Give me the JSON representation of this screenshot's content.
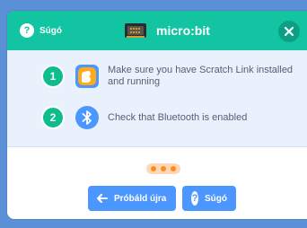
{
  "header": {
    "help_label": "Súgó",
    "title": "micro:bit",
    "close_icon": "close-icon"
  },
  "steps": [
    {
      "number": "1",
      "icon": "scratch-link-icon",
      "text": "Make sure you have Scratch Link installed and running"
    },
    {
      "number": "2",
      "icon": "bluetooth-icon",
      "text": "Check that Bluetooth is enabled"
    }
  ],
  "footer": {
    "back_label": "Próbáld újra",
    "help_label": "Súgó"
  },
  "colors": {
    "header": "#13c4a3",
    "accent": "#4c97ff",
    "step_badge": "#0fbd8c",
    "dots": "#ff8c1a"
  }
}
